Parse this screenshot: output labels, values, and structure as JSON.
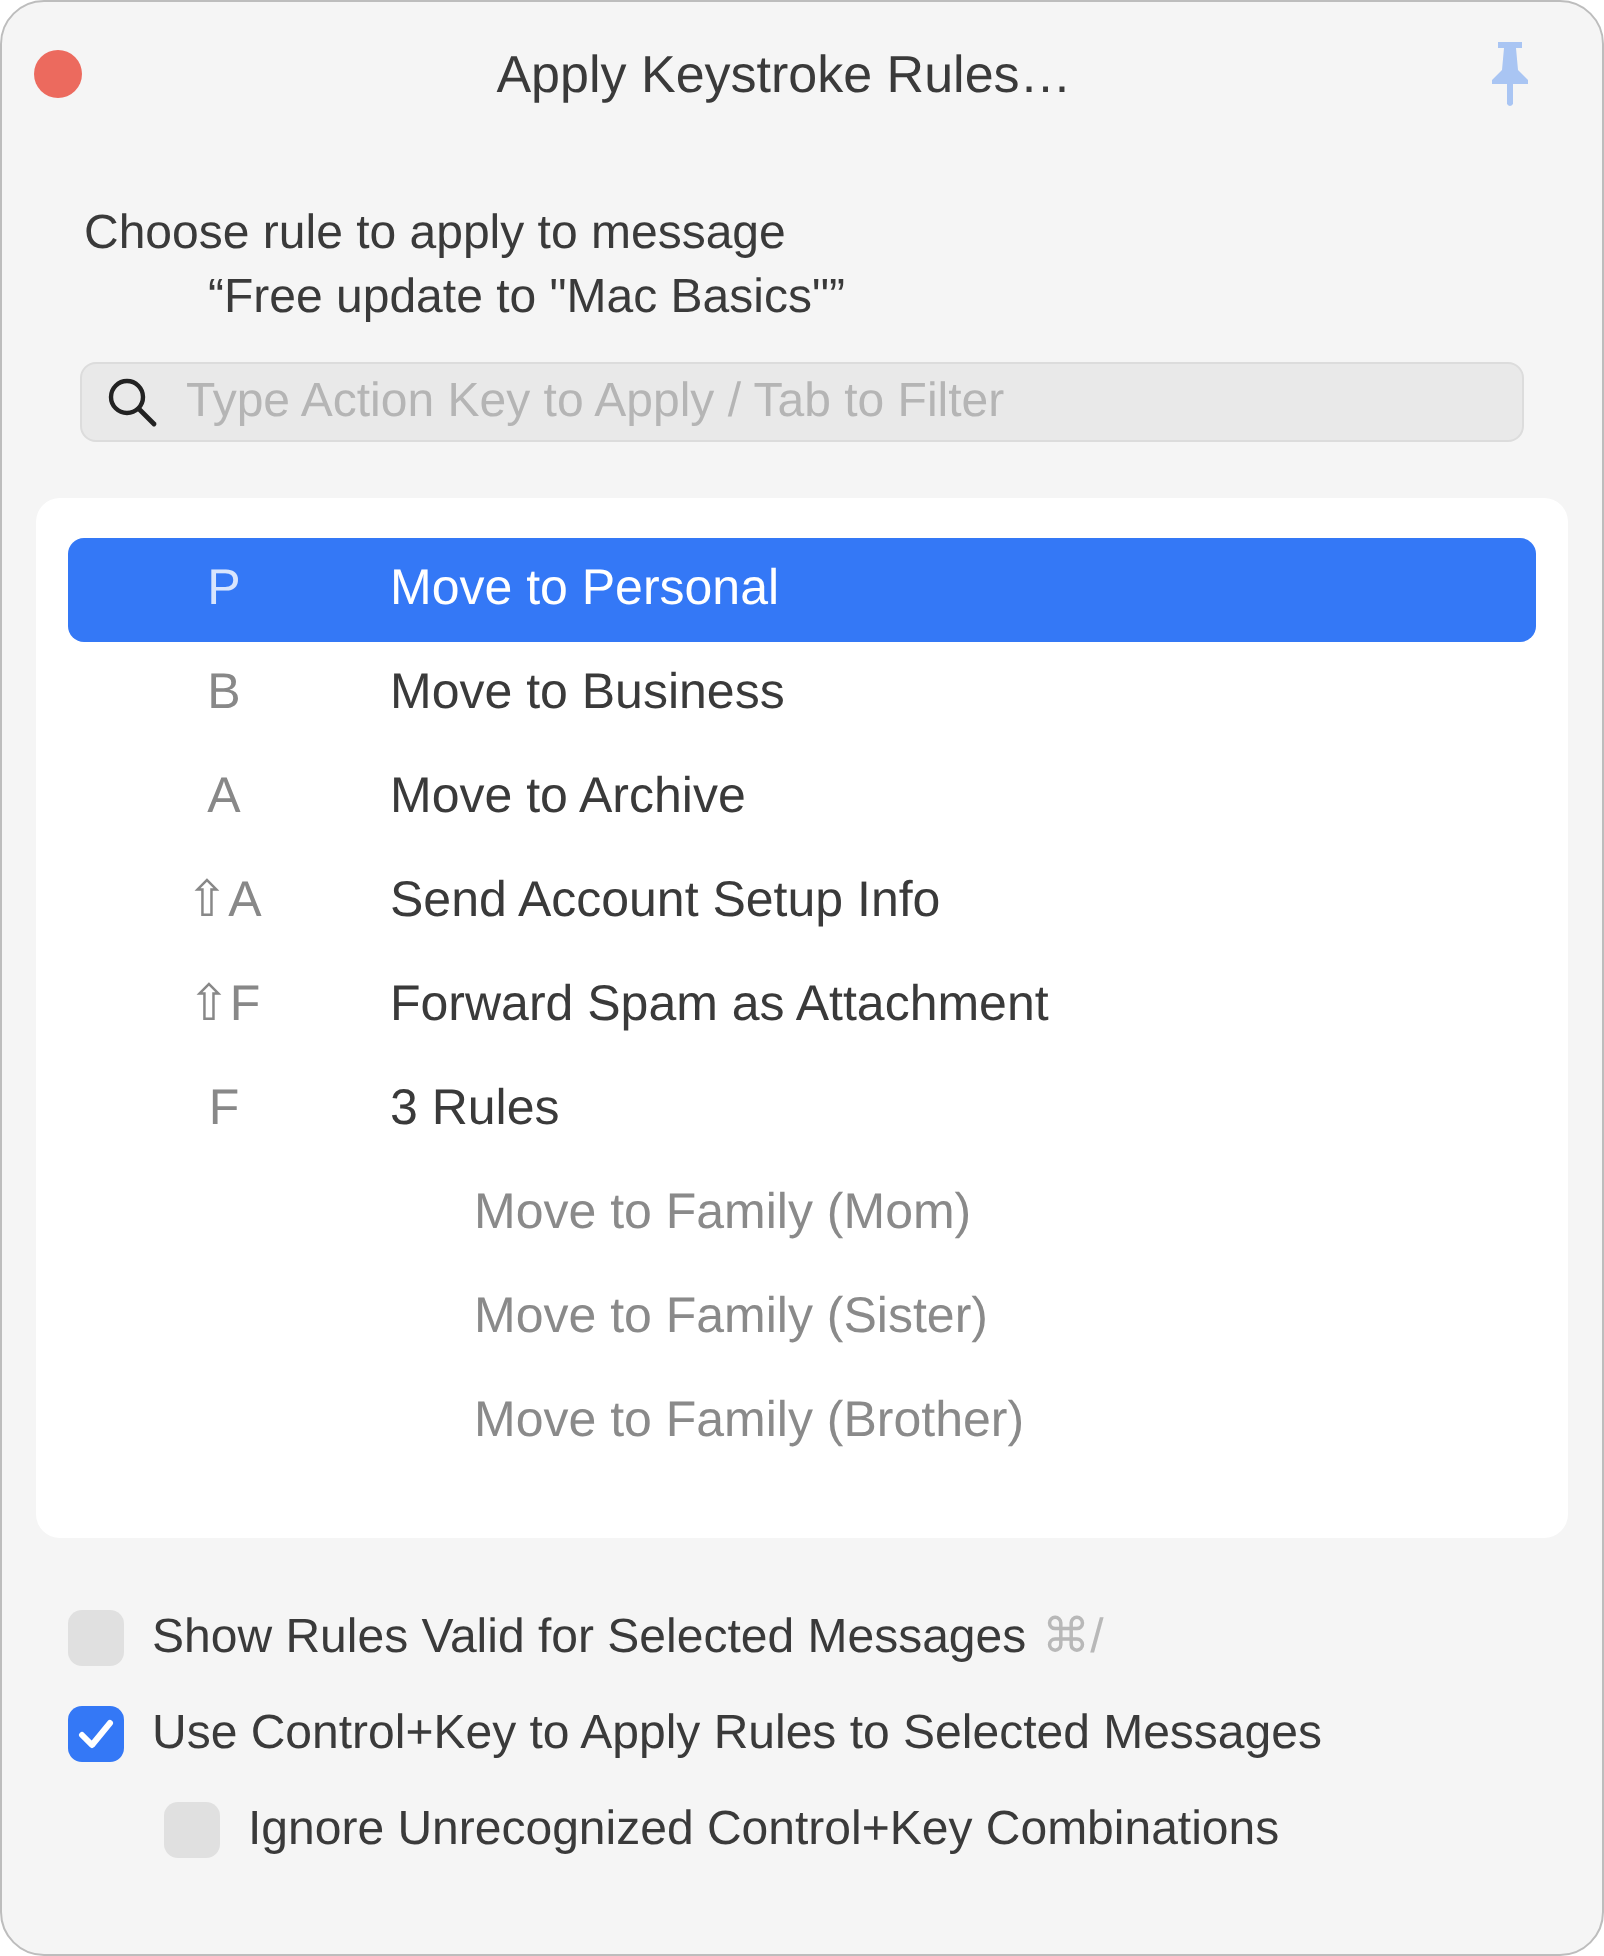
{
  "window": {
    "title": "Apply Keystroke Rules…"
  },
  "prompt": {
    "line_1": "Choose rule to apply to message",
    "line_2": "“Free update to \"Mac Basics\"”"
  },
  "search": {
    "placeholder": "Type Action Key to Apply / Tab to Filter"
  },
  "rules": [
    {
      "key": "P",
      "label": "Move to Personal",
      "selected": true
    },
    {
      "key": "B",
      "label": "Move to Business",
      "selected": false
    },
    {
      "key": "A",
      "label": "Move to Archive",
      "selected": false
    },
    {
      "key": "⇧A",
      "label": "Send Account Setup Info",
      "selected": false
    },
    {
      "key": "⇧F",
      "label": "Forward Spam as Attachment",
      "selected": false
    },
    {
      "key": "F",
      "label": "3 Rules",
      "selected": false,
      "children": [
        {
          "label": "Move to Family (Mom)"
        },
        {
          "label": "Move to Family (Sister)"
        },
        {
          "label": "Move to Family (Brother)"
        }
      ]
    }
  ],
  "options": [
    {
      "label": "Show Rules Valid for Selected Messages",
      "shortcut": "⌘/",
      "checked": false
    },
    {
      "label": "Use Control+Key to Apply Rules to Selected Messages",
      "checked": true,
      "children": [
        {
          "label": "Ignore Unrecognized Control+Key Combinations",
          "checked": false
        }
      ]
    }
  ]
}
